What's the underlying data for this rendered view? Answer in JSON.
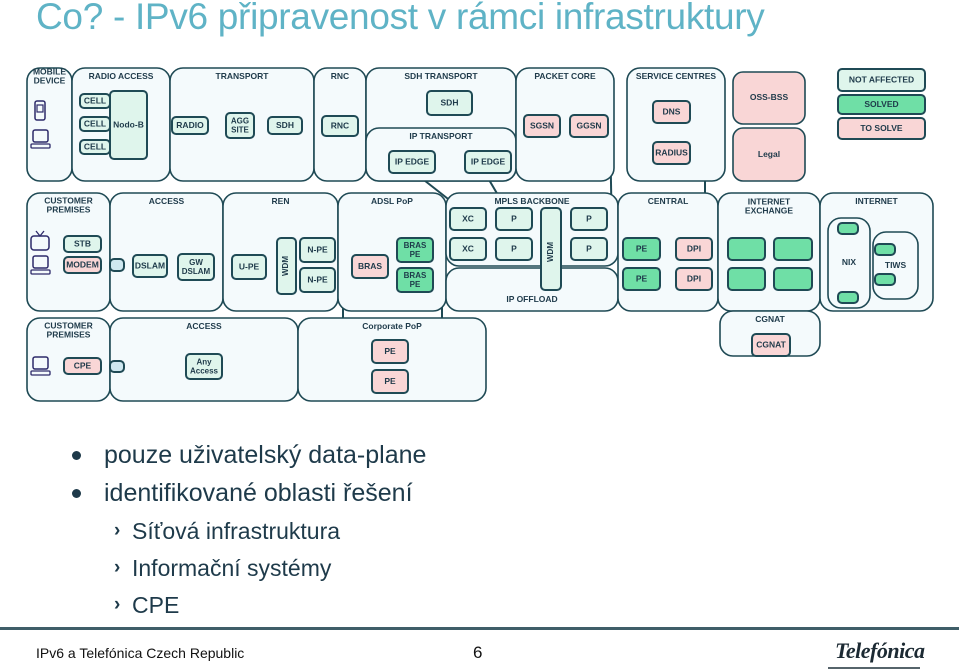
{
  "title": "Co? - IPv6 připravenost v rámci infrastruktury",
  "colors": {
    "zone_fill": "#f4fafc",
    "stroke": "#1f4a55",
    "not_affected": "#dff5ec",
    "solved": "#6fdfa6",
    "to_solve": "#f9d6d6",
    "link_box": "#cfe8f0",
    "title": "#5fb3c6",
    "text": "#1e3a4a"
  },
  "legend": {
    "not_affected": "NOT AFFECTED",
    "solved": "SOLVED",
    "to_solve": "TO SOLVE"
  },
  "diagram": {
    "zones": {
      "mobile_device": "MOBILE\nDEVICE",
      "radio_access": "RADIO ACCESS",
      "transport": "TRANSPORT",
      "rnc": "RNC",
      "sdh_transport": "SDH TRANSPORT",
      "ip_transport": "IP TRANSPORT",
      "packet_core": "PACKET CORE",
      "service_centres": "SERVICE CENTRES",
      "customer_premises": "CUSTOMER\nPREMISES",
      "access": "ACCESS",
      "ren": "REN",
      "adsl_pop": "ADSL PoP",
      "mpls_backbone": "MPLS BACKBONE",
      "ip_offload": "IP OFFLOAD",
      "central": "CENTRAL",
      "internet_exchange": "INTERNET\nEXCHANGE",
      "internet": "INTERNET",
      "nix": "NIX",
      "tiws": "TIWS",
      "customer_premises_corp": "CUSTOMER\nPREMISES",
      "access_corp": "ACCESS",
      "corporate_pop": "Corporate PoP",
      "cgnat_zone": "CGNAT"
    },
    "nodes": {
      "cell": "CELL",
      "nodeb": "Nodo-B",
      "radio": "RADIO",
      "agg_site": "AGG\nSITE",
      "sdh": "SDH",
      "rnc": "RNC",
      "ip_edge": "IP EDGE",
      "sgsn": "SGSN",
      "ggsn": "GGSN",
      "dns": "DNS",
      "radius": "RADIUS",
      "oss_bss": "OSS-BSS",
      "legal": "Legal",
      "stb": "STB",
      "modem": "MODEM",
      "dslam": "DSLAM",
      "gw_dslam": "GW\nDSLAM",
      "upe": "U-PE",
      "wdm": "WDM",
      "npe": "N-PE",
      "bras": "BRAS",
      "bras_pe": "BRAS\nPE",
      "xc": "XC",
      "p": "P",
      "pe": "PE",
      "dpi": "DPI",
      "cpe": "CPE",
      "any_access": "Any\nAccess",
      "cgnat": "CGNAT"
    }
  },
  "bullets": [
    {
      "text": "pouze uživatelský data-plane",
      "sub": []
    },
    {
      "text": "identifikované oblasti řešení",
      "sub": [
        "Síťová infrastruktura",
        "Informační systémy",
        "CPE"
      ]
    }
  ],
  "sub_marker": "›",
  "footer": {
    "text": "IPv6 a Telefónica Czech Republic",
    "page": "6",
    "logo": "Telefónica"
  }
}
